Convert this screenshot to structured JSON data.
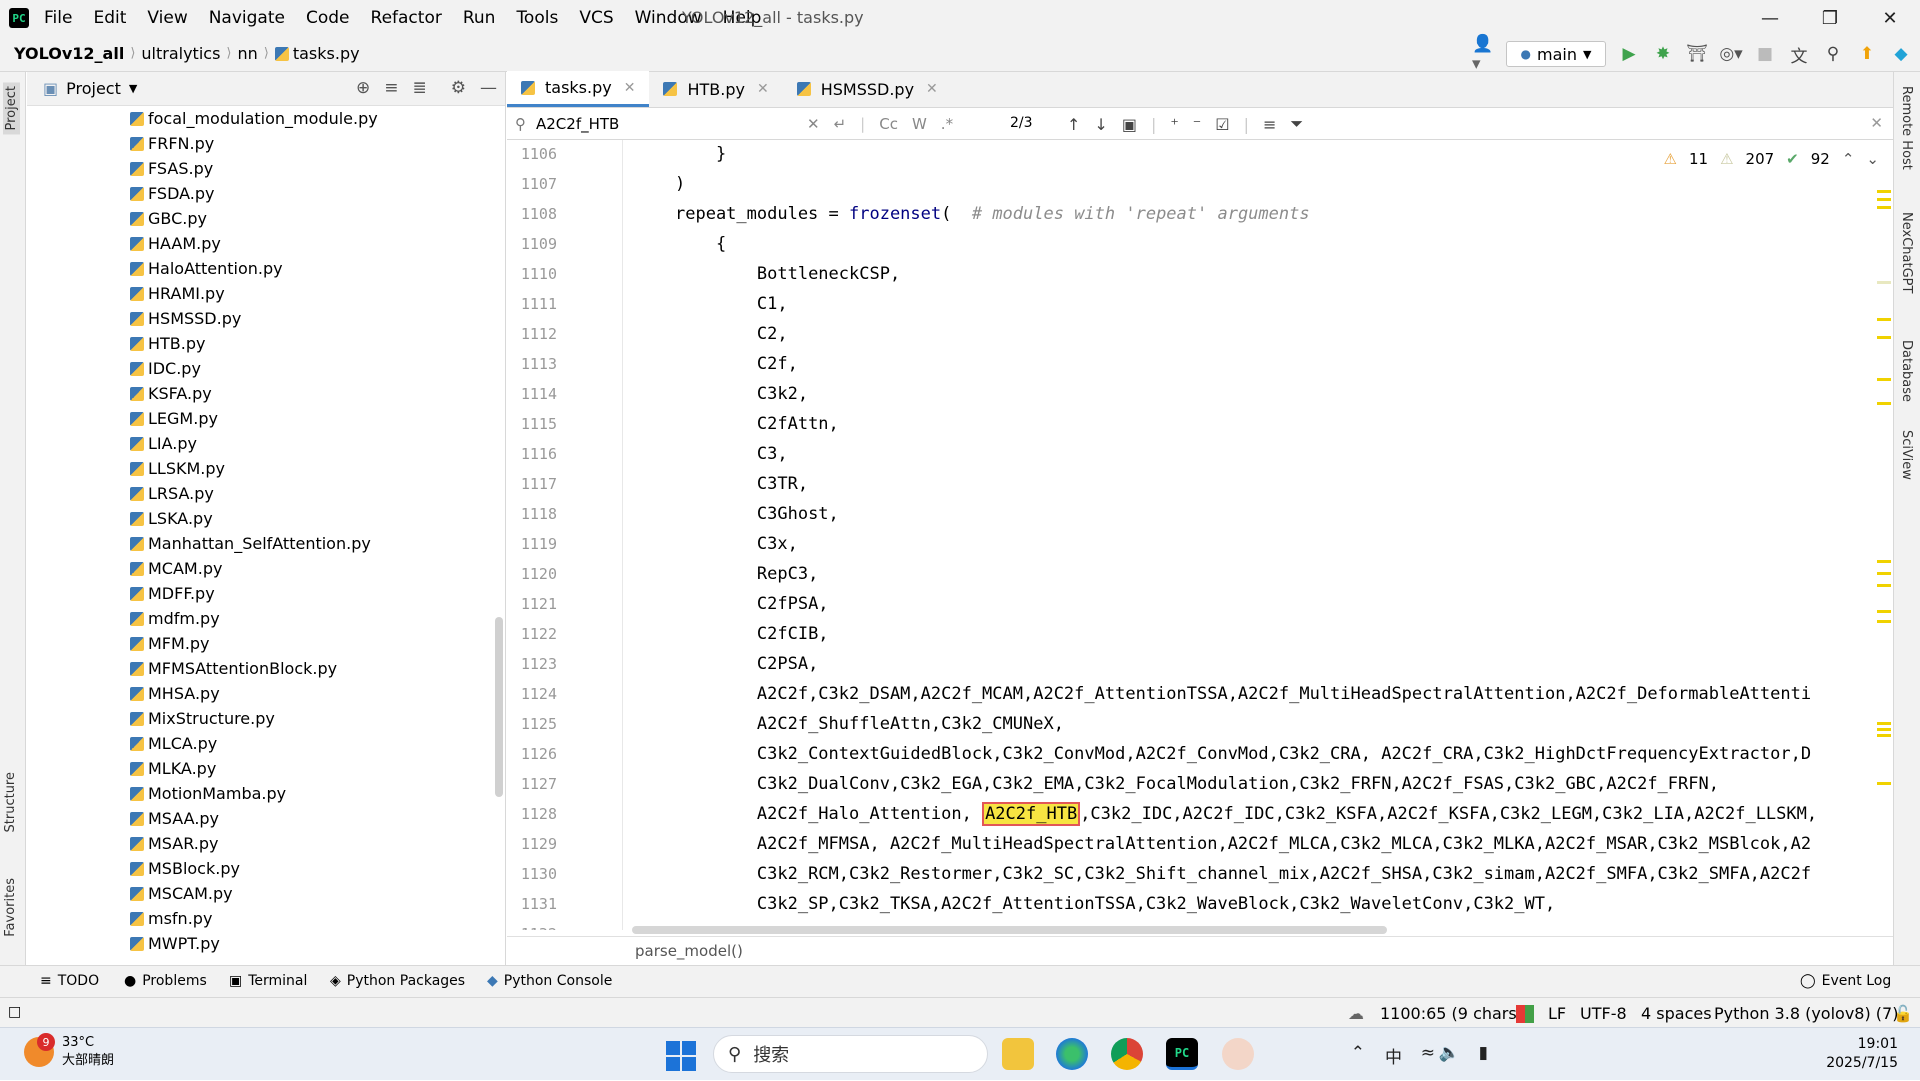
{
  "window": {
    "title": "YOLOv12_all - tasks.py",
    "menu": [
      "File",
      "Edit",
      "View",
      "Navigate",
      "Code",
      "Refactor",
      "Run",
      "Tools",
      "VCS",
      "Window",
      "Help"
    ]
  },
  "navbar": {
    "breadcrumb": [
      "YOLOv12_all",
      "ultralytics",
      "nn",
      "tasks.py"
    ],
    "branch": "main"
  },
  "project_panel": {
    "title": "Project",
    "files": [
      "focal_modulation_module.py",
      "FRFN.py",
      "FSAS.py",
      "FSDA.py",
      "GBC.py",
      "HAAM.py",
      "HaloAttention.py",
      "HRAMI.py",
      "HSMSSD.py",
      "HTB.py",
      "IDC.py",
      "KSFA.py",
      "LEGM.py",
      "LIA.py",
      "LLSKM.py",
      "LRSA.py",
      "LSKA.py",
      "Manhattan_SelfAttention.py",
      "MCAM.py",
      "MDFF.py",
      "mdfm.py",
      "MFM.py",
      "MFMSAttentionBlock.py",
      "MHSA.py",
      "MixStructure.py",
      "MLCA.py",
      "MLKA.py",
      "MotionMamba.py",
      "MSAA.py",
      "MSAR.py",
      "MSBlock.py",
      "MSCAM.py",
      "msfn.py",
      "MWPT.py"
    ]
  },
  "left_strip": {
    "project": "Project",
    "structure": "Structure",
    "favorites": "Favorites"
  },
  "right_strip": {
    "remote_host": "Remote Host",
    "nexchatgpt": "NexChatGPT",
    "database": "Database",
    "sciview": "SciView"
  },
  "tabs": [
    {
      "label": "tasks.py"
    },
    {
      "label": "HTB.py"
    },
    {
      "label": "HSMSSD.py"
    }
  ],
  "search": {
    "query": "A2C2f_HTB",
    "opt_case": "Cc",
    "opt_word": "W",
    "opt_regex": ".*",
    "match_count": "2/3"
  },
  "inspections": {
    "warnings_a": "11",
    "warnings_b": "207",
    "ok": "92"
  },
  "code": {
    "lines": [
      {
        "n": "1106",
        "indent": "    ",
        "t": "}"
      },
      {
        "n": "1107",
        "indent": "",
        "t": ")"
      },
      {
        "n": "1108",
        "indent": "",
        "t": "repeat_modules = ",
        "kw": "frozenset",
        "after": "(  ",
        "comment": "# modules with 'repeat' arguments"
      },
      {
        "n": "1109",
        "indent": "    ",
        "t": "{"
      },
      {
        "n": "1110",
        "indent": "        ",
        "t": "BottleneckCSP,"
      },
      {
        "n": "1111",
        "indent": "        ",
        "t": "C1,"
      },
      {
        "n": "1112",
        "indent": "        ",
        "t": "C2,"
      },
      {
        "n": "1113",
        "indent": "        ",
        "t": "C2f,"
      },
      {
        "n": "1114",
        "indent": "        ",
        "t": "C3k2,"
      },
      {
        "n": "1115",
        "indent": "        ",
        "t": "C2fAttn,"
      },
      {
        "n": "1116",
        "indent": "        ",
        "t": "C3,"
      },
      {
        "n": "1117",
        "indent": "        ",
        "t": "C3TR,"
      },
      {
        "n": "1118",
        "indent": "        ",
        "t": "C3Ghost,"
      },
      {
        "n": "1119",
        "indent": "        ",
        "t": "C3x,"
      },
      {
        "n": "1120",
        "indent": "        ",
        "t": "RepC3,"
      },
      {
        "n": "1121",
        "indent": "        ",
        "t": "C2fPSA,"
      },
      {
        "n": "1122",
        "indent": "        ",
        "t": "C2fCIB,"
      },
      {
        "n": "1123",
        "indent": "        ",
        "t": "C2PSA,"
      },
      {
        "n": "1124",
        "indent": "        ",
        "t": "A2C2f,C3k2_DSAM,A2C2f_MCAM,A2C2f_AttentionTSSA,A2C2f_MultiHeadSpectralAttention,A2C2f_DeformableAttenti"
      },
      {
        "n": "1125",
        "indent": "        ",
        "t": "A2C2f_ShuffleAttn,C3k2_CMUNeX,"
      },
      {
        "n": "1126",
        "indent": "        ",
        "t": "C3k2_ContextGuidedBlock,C3k2_ConvMod,A2C2f_ConvMod,C3k2_CRA, A2C2f_CRA,C3k2_HighDctFrequencyExtractor,D"
      },
      {
        "n": "1127",
        "indent": "        ",
        "t": "C3k2_DualConv,C3k2_EGA,C3k2_EMA,C3k2_FocalModulation,C3k2_FRFN,A2C2f_FSAS,C3k2_GBC,A2C2f_FRFN,"
      },
      {
        "n": "1128",
        "indent": "        ",
        "t": "A2C2f_Halo_Attention, ",
        "match": "A2C2f_HTB",
        "after": ",C3k2_IDC,A2C2f_IDC,C3k2_KSFA,A2C2f_KSFA,C3k2_LEGM,C3k2_LIA,A2C2f_LLSKM,"
      },
      {
        "n": "1129",
        "indent": "        ",
        "t": "A2C2f_MFMSA, A2C2f_MultiHeadSpectralAttention,A2C2f_MLCA,C3k2_MLCA,C3k2_MLKA,A2C2f_MSAR,C3k2_MSBlcok,A2"
      },
      {
        "n": "1130",
        "indent": "        ",
        "t": "C3k2_RCM,C3k2_Restormer,C3k2_SC,C3k2_Shift_channel_mix,A2C2f_SHSA,C3k2_simam,A2C2f_SMFA,C3k2_SMFA,A2C2f"
      },
      {
        "n": "1131",
        "indent": "        ",
        "t": "C3k2_SP,C3k2_TKSA,A2C2f_AttentionTSSA,C3k2_WaveBlock,C3k2_WaveletConv,C3k2_WT,"
      },
      {
        "n": "1132",
        "indent": "",
        "t": ""
      }
    ],
    "footer_breadcrumb": "parse_model()"
  },
  "tool_windows": {
    "todo": "TODO",
    "problems": "Problems",
    "terminal": "Terminal",
    "packages": "Python Packages",
    "console": "Python Console",
    "event_log": "Event Log"
  },
  "status": {
    "position": "1100:65 (9 chars)",
    "line_sep": "LF",
    "encoding": "UTF-8",
    "indent": "4 spaces",
    "interpreter": "Python 3.8 (yolov8) (7)"
  },
  "taskbar": {
    "weather_temp": "33°C",
    "weather_desc": "大部晴朗",
    "weather_badge": "9",
    "search_placeholder": "搜索",
    "ime": "中",
    "time": "19:01",
    "date": "2025/7/15"
  }
}
